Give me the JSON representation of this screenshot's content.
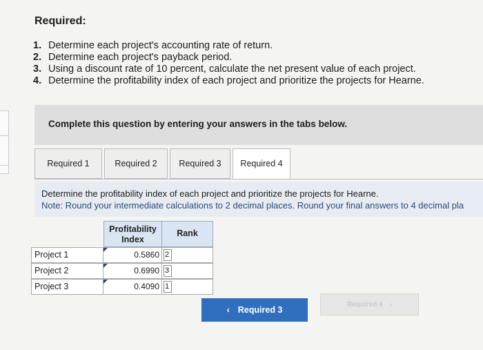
{
  "heading": "Required:",
  "requirements": [
    {
      "num": "1.",
      "text": "Determine each project's accounting rate of return."
    },
    {
      "num": "2.",
      "text": "Determine each project's payback period."
    },
    {
      "num": "3.",
      "text": "Using a discount rate of 10 percent, calculate the net present value of each project."
    },
    {
      "num": "4.",
      "text": "Determine the profitability index of each project and prioritize the projects for Hearne."
    }
  ],
  "instruction": "Complete this question by entering your answers in the tabs below.",
  "tabs": [
    {
      "label": "Required 1"
    },
    {
      "label": "Required 2"
    },
    {
      "label": "Required 3"
    },
    {
      "label": "Required 4"
    }
  ],
  "note": {
    "line1": "Determine the profitability index of each project and prioritize the projects for Hearne.",
    "line2": "Note: Round your intermediate calculations to 2 decimal places. Round your final answers to 4 decimal pla"
  },
  "table": {
    "col_pi": "Profitability Index",
    "col_rank": "Rank",
    "rows": [
      {
        "label": "Project 1",
        "pi": "0.5860",
        "rank": "2"
      },
      {
        "label": "Project 2",
        "pi": "0.6990",
        "rank": "3"
      },
      {
        "label": "Project 3",
        "pi": "0.4090",
        "rank": "1"
      }
    ]
  },
  "nav": {
    "prev_label": "Required 3",
    "prev_icon": "chevron-left-icon",
    "next_label": "Required 4",
    "next_icon": "chevron-right-icon"
  },
  "colors": {
    "accent": "#2f6fbd",
    "note_bg": "#e7ecf3",
    "header_bg": "#d9e5f3"
  }
}
